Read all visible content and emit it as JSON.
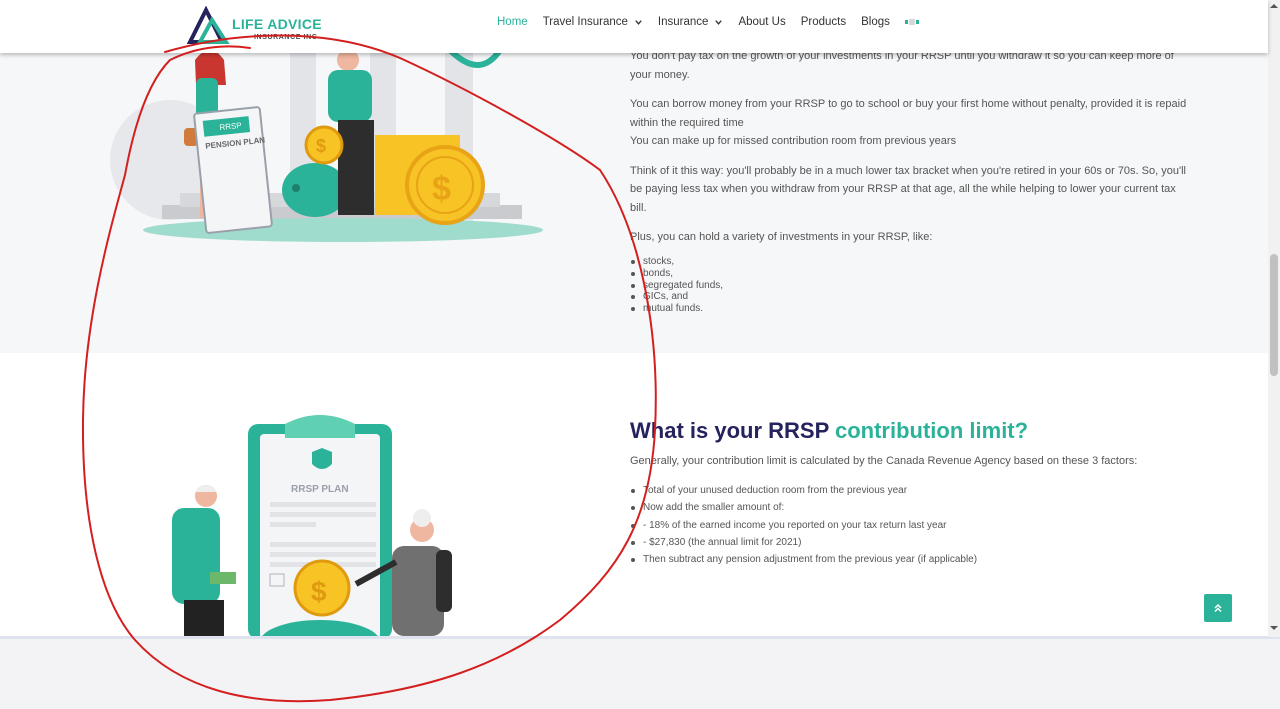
{
  "header": {
    "logo": {
      "name": "LIFE ADVICE",
      "subtitle": "INSURANCE INC"
    },
    "nav": [
      {
        "label": "Home",
        "active": true,
        "dropdown": false
      },
      {
        "label": "Travel Insurance",
        "active": false,
        "dropdown": true
      },
      {
        "label": "Insurance",
        "active": false,
        "dropdown": true
      },
      {
        "label": "About Us",
        "active": false,
        "dropdown": false
      },
      {
        "label": "Products",
        "active": false,
        "dropdown": false
      },
      {
        "label": "Blogs",
        "active": false,
        "dropdown": false
      }
    ]
  },
  "benefits": {
    "paragraphs": [
      "You don't pay tax on the growth of your investments in your RRSP until you withdraw it so you can keep more of your money.",
      "You can borrow money from your RRSP to go to school or buy your first home without penalty, provided it is repaid within the required time",
      "You can make up for missed contribution room from previous years",
      "Think of it this way: you'll probably be in a much lower tax bracket when you're retired in your 60s or 70s. So, you'll be paying less tax when you withdraw from your RRSP at that age, all the while helping to lower your current tax bill.",
      "Plus, you can hold a variety of investments in your RRSP, like:"
    ],
    "investments": [
      "stocks,",
      "bonds,",
      "segregated funds,",
      "GICs, and",
      "mutual funds."
    ],
    "illustration": {
      "sign_line1": "RRSP",
      "sign_line2": "PENSION PLAN"
    }
  },
  "contribution": {
    "title_part1": "What is your RRSP",
    "title_part2": "contribution limit?",
    "intro": "Generally, your contribution limit is calculated by the Canada Revenue Agency based on these 3 factors:",
    "factors": [
      "Total of your unused deduction room from the previous year",
      "Now add the smaller amount of:",
      "- 18% of the earned income you reported on your tax return last year",
      "- $27,830 (the annual limit for 2021)",
      "Then subtract any pension adjustment from the previous year (if applicable)"
    ],
    "illustration": {
      "clipboard_label": "RRSP PLAN"
    }
  },
  "colors": {
    "accent": "#2bb39a",
    "heading": "#25235d",
    "annotation": "#d41f1f"
  },
  "icons": {
    "back_to_top": "double-chevron-up-icon",
    "dropdown": "chevron-down-icon"
  }
}
